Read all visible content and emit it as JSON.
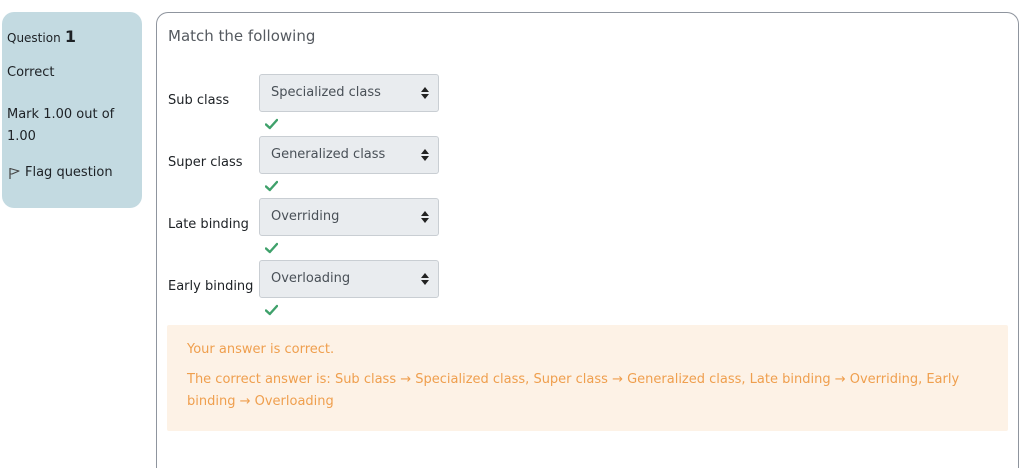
{
  "info": {
    "question_label": "Question",
    "question_number": "1",
    "state": "Correct",
    "grade": "Mark 1.00 out of 1.00",
    "flag_label": "Flag question"
  },
  "question": {
    "text": "Match the following",
    "rows": [
      {
        "label": "Sub class",
        "selected": "Specialized class",
        "correct": true
      },
      {
        "label": "Super class",
        "selected": "Generalized class",
        "correct": true
      },
      {
        "label": "Late binding",
        "selected": "Overriding",
        "correct": true
      },
      {
        "label": "Early binding",
        "selected": "Overloading",
        "correct": true
      }
    ]
  },
  "feedback": {
    "specific": "Your answer is correct.",
    "right_answer": "The correct answer is: Sub class → Specialized class, Super class → Generalized class, Late binding → Overriding, Early binding → Overloading"
  },
  "colors": {
    "info_bg": "#c3dae1",
    "check_green": "#3fa16b",
    "feedback_text": "#ef9f4e",
    "feedback_bg": "#fdf2e6"
  }
}
